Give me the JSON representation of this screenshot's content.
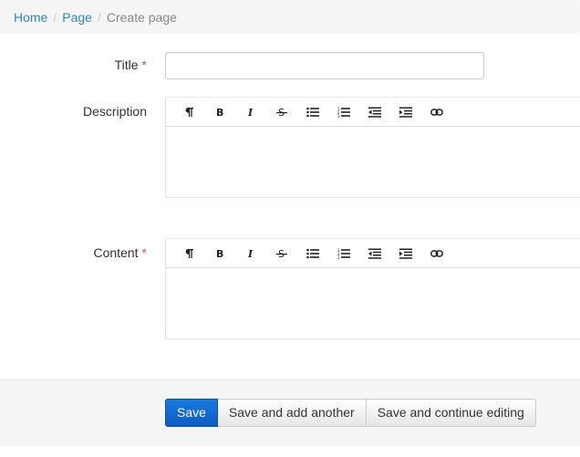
{
  "breadcrumb": {
    "items": [
      {
        "label": "Home"
      },
      {
        "label": "Page"
      }
    ],
    "separator": "/",
    "active": "Create page"
  },
  "form": {
    "title_label": "Title",
    "description_label": "Description",
    "content_label": "Content",
    "required_marker": "*",
    "title_value": "",
    "title_placeholder": ""
  },
  "toolbar": {
    "buttons": [
      {
        "icon": "paragraph-icon",
        "glyph": "¶"
      },
      {
        "icon": "bold-icon",
        "glyph": "B"
      },
      {
        "icon": "italic-icon",
        "glyph": "I"
      },
      {
        "icon": "strikethrough-icon",
        "glyph": "S"
      },
      {
        "icon": "bulleted-list-icon"
      },
      {
        "icon": "numbered-list-icon"
      },
      {
        "icon": "outdent-icon"
      },
      {
        "icon": "indent-icon"
      },
      {
        "icon": "link-icon"
      }
    ]
  },
  "actions": {
    "save": "Save",
    "save_add": "Save and add another",
    "save_continue": "Save and continue editing"
  },
  "colors": {
    "link": "#2a86c4",
    "required": "#d9534f",
    "primary": "#0b5cc0"
  }
}
